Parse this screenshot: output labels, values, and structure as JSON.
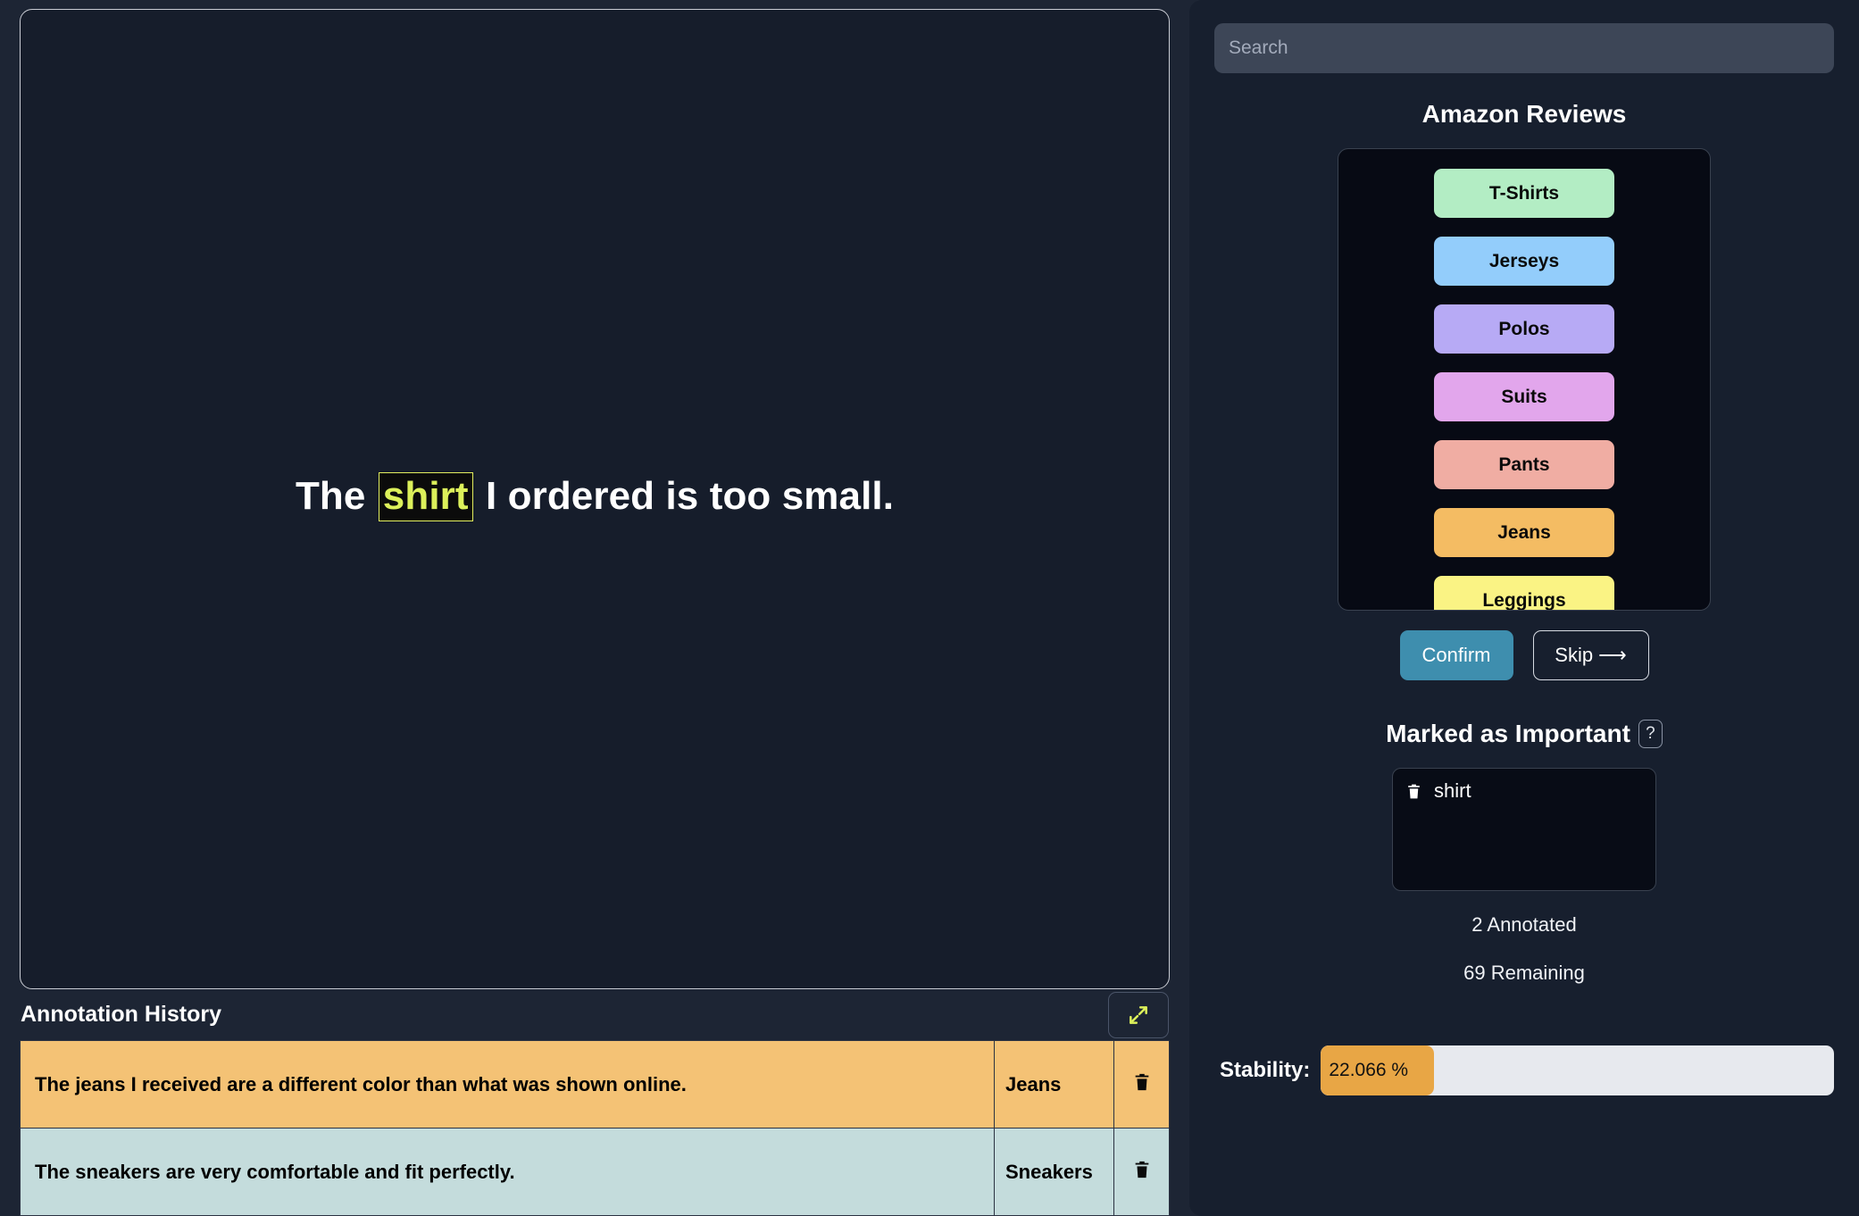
{
  "main": {
    "sentence": {
      "before": "The ",
      "highlight": "shirt",
      "after": " I ordered is too small."
    }
  },
  "history": {
    "title": "Annotation History",
    "expand_icon": "expand-diagonal-icon",
    "delete_icon": "trash-icon",
    "rows": [
      {
        "text": "The jeans I received are a different color than what was shown online.",
        "label": "Jeans",
        "color": "#f4c275"
      },
      {
        "text": "The sneakers are very comfortable and fit perfectly.",
        "label": "Sneakers",
        "color": "#c4dcdc"
      }
    ]
  },
  "sidebar": {
    "search": {
      "placeholder": "Search",
      "value": ""
    },
    "title": "Amazon Reviews",
    "categories": [
      {
        "label": "T-Shirts",
        "color": "#b3edc4"
      },
      {
        "label": "Jerseys",
        "color": "#93cdfb"
      },
      {
        "label": "Polos",
        "color": "#b7aaf5"
      },
      {
        "label": "Suits",
        "color": "#e2a6ec"
      },
      {
        "label": "Pants",
        "color": "#f0ada3"
      },
      {
        "label": "Jeans",
        "color": "#f4bc63"
      },
      {
        "label": "Leggings",
        "color": "#faf384"
      }
    ],
    "actions": {
      "confirm": "Confirm",
      "skip": "Skip ⟶"
    },
    "important": {
      "title": "Marked as Important",
      "help": "?",
      "items": [
        {
          "label": "shirt",
          "icon": "trash-icon"
        }
      ]
    },
    "counts": {
      "annotated": "2 Annotated",
      "remaining": "69 Remaining"
    },
    "stability": {
      "label": "Stability:",
      "value": "22.066 %",
      "percent": 22.066,
      "fill_color": "#e8a645",
      "track_color": "#e7e9ee"
    }
  }
}
